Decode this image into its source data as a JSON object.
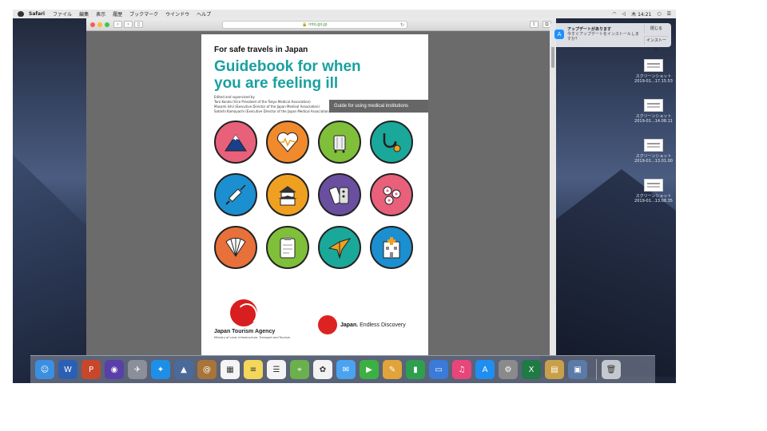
{
  "menubar": {
    "app_name": "Safari",
    "menus": [
      "ファイル",
      "編集",
      "表示",
      "履歴",
      "ブックマーク",
      "ウインドウ",
      "ヘルプ"
    ],
    "clock": "木 14:21"
  },
  "browser": {
    "url": "into.go.jp"
  },
  "pdf": {
    "kicker": "For safe travels in Japan",
    "title": "Guidebook for when you are feeling ill",
    "editors": [
      "Edited and supervised by",
      "Taro Kondo (Vice President of the Tokyo Medical Association)",
      "Masami Ishii (Executive Director of the Japan Medical Association)",
      "Satoshi Kamayachi (Executive Director of the Japan Medical Association)"
    ],
    "banner": "Guide for using medical institutions",
    "illustrations": [
      {
        "name": "mount-fuji",
        "color": "#e8607a"
      },
      {
        "name": "heart-pulse",
        "color": "#f08a2c"
      },
      {
        "name": "suitcase",
        "color": "#7fbf3a"
      },
      {
        "name": "stethoscope",
        "color": "#1aa89a"
      },
      {
        "name": "syringe",
        "color": "#1b8fd0"
      },
      {
        "name": "castle",
        "color": "#f0a020"
      },
      {
        "name": "medicine",
        "color": "#6a4fa0"
      },
      {
        "name": "cherry-blossom",
        "color": "#e8607a"
      },
      {
        "name": "fan",
        "color": "#e8703a"
      },
      {
        "name": "clipboard",
        "color": "#7fbf3a"
      },
      {
        "name": "paper-crane",
        "color": "#1aa89a"
      },
      {
        "name": "hospital",
        "color": "#1b8fd0"
      }
    ],
    "agency_name": "Japan Tourism Agency",
    "agency_sub": "Ministry of Land, Infrastructure, Transport and Tourism",
    "brand_bold": "Japan.",
    "brand_rest": " Endless Discovery"
  },
  "notification": {
    "title": "アップデートがあります",
    "body": "今すぐアップデートをインストールしますか？",
    "close_label": "閉じる",
    "install_label": "インストール"
  },
  "desktop_files": [
    {
      "label": "スクリーンショット 2019-01...17.15.53"
    },
    {
      "label": "スクリーンショット 2019-01...14.08.11"
    },
    {
      "label": "スクリーンショット 2019-01...13.01.00"
    },
    {
      "label": "スクリーンショット 2019-01...13.08.35"
    }
  ],
  "dock": [
    {
      "name": "finder",
      "color": "#3b8fe0",
      "glyph": "☺"
    },
    {
      "name": "word",
      "color": "#2b5fb4",
      "glyph": "W"
    },
    {
      "name": "powerpoint",
      "color": "#c8472a",
      "glyph": "P"
    },
    {
      "name": "siri",
      "color": "#5a3fa8",
      "glyph": "◉"
    },
    {
      "name": "launchpad",
      "color": "#8a8f9a",
      "glyph": "✈"
    },
    {
      "name": "safari",
      "color": "#1e8fe8",
      "glyph": "✦"
    },
    {
      "name": "photo-app",
      "color": "#4b6a9a",
      "glyph": "▲"
    },
    {
      "name": "contacts",
      "color": "#a8743a",
      "glyph": "@"
    },
    {
      "name": "calendar",
      "color": "#f4f4f4",
      "glyph": "▦"
    },
    {
      "name": "notes",
      "color": "#f3d75a",
      "glyph": "≡"
    },
    {
      "name": "reminders",
      "color": "#f4f4f4",
      "glyph": "☰"
    },
    {
      "name": "maps",
      "color": "#6ab04c",
      "glyph": "⌖"
    },
    {
      "name": "photos",
      "color": "#f2f2f2",
      "glyph": "✿"
    },
    {
      "name": "messages",
      "color": "#4aa3f0",
      "glyph": "✉"
    },
    {
      "name": "facetime",
      "color": "#3cb043",
      "glyph": "▶"
    },
    {
      "name": "preview",
      "color": "#e0a43a",
      "glyph": "✎"
    },
    {
      "name": "numbers",
      "color": "#2e9e4f",
      "glyph": "▮"
    },
    {
      "name": "keynote",
      "color": "#3a7ad8",
      "glyph": "▭"
    },
    {
      "name": "itunes",
      "color": "#e8467a",
      "glyph": "♫"
    },
    {
      "name": "app-store",
      "color": "#1f8ef0",
      "glyph": "A"
    },
    {
      "name": "system-preferences",
      "color": "#8a8a8a",
      "glyph": "⚙"
    },
    {
      "name": "excel",
      "color": "#1f7a44",
      "glyph": "X"
    },
    {
      "name": "archive",
      "color": "#c9a04a",
      "glyph": "▤"
    },
    {
      "name": "image-capture",
      "color": "#5a7aa8",
      "glyph": "▣"
    },
    {
      "name": "trash",
      "color": "#c4c8cf",
      "glyph": "🗑"
    }
  ]
}
